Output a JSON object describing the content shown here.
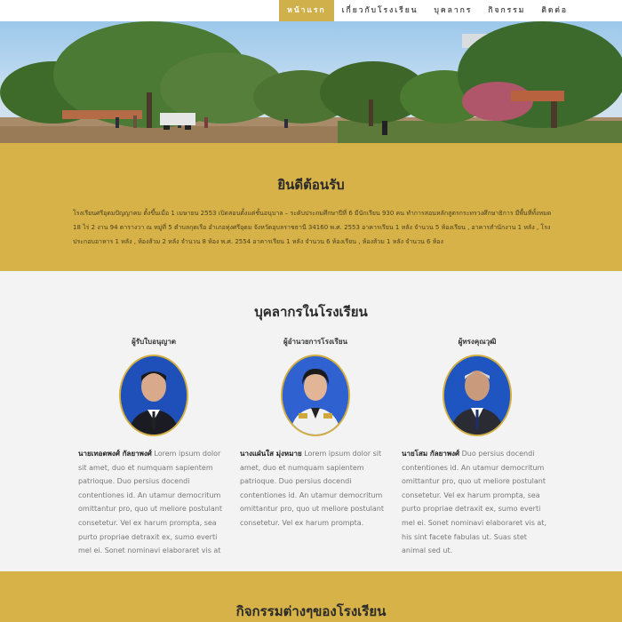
{
  "nav": {
    "items": [
      {
        "label": "หน้าแรก",
        "active": true
      },
      {
        "label": "เกี่ยวกับโรงเรียน",
        "active": false
      },
      {
        "label": "บุคลากร",
        "active": false
      },
      {
        "label": "กิจกรรม",
        "active": false
      },
      {
        "label": "ติดต่อ",
        "active": false
      }
    ]
  },
  "welcome": {
    "title": "ยินดีต้อนรับ",
    "text": "โรงเรียนศรีอุดมปัญญาคม ตั้งขึ้นเมื่อ 1 เมษายน 2553 เปิดสอนตั้งแต่ชั้นอนุบาล – ระดับประถมศึกษาปีที่ 6 มีนักเรียน 930 คน ทำการสอนหลักสูตรกระทรวงศึกษาธิการ มีพื้นที่ทั้งหมด 18 ไร่ 2 งาน 94 ตารางวา ณ หมู่ที่ 5 ตำบลกุดเรือ อำเภอทุ่งศรีอุดม จังหวัดอุบลราชธานี 34160 พ.ศ. 2553 อาคารเรียน 1 หลัง จำนวน 5 ห้องเรียน , อาคารสำนักงาน 1 หลัง , โรงประกอบอาหาร 1 หลัง , ห้องส้วม 2 หลัง จำนวน 8 ห้อง พ.ศ. 2554 อาคารเรียน 1 หลัง จำนวน 6 ห้องเรียน , ห้องส้วม 1 หลัง จำนวน 6 ห้อง"
  },
  "staff": {
    "title": "บุคลากรในโรงเรียน",
    "people": [
      {
        "role": "ผู้รับใบอนุญาต",
        "name": "นายเทอดพงศ์ กัลยาพงศ์",
        "desc": " Lorem ipsum dolor sit amet, duo et numquam sapientem patrioque. Duo persius docendi contentiones id. An utamur democritum omittantur pro, quo ut meliore postulant consetetur. Vel ex harum prompta, sea purto propriae detraxit ex, sumo everti mel ei. Sonet nominavi elaboraret vis at"
      },
      {
        "role": "ผู้อำนวยการโรงเรียน",
        "name": "นางแฝ่นใส มุ่งหมาย",
        "desc": " Lorem ipsum dolor sit amet, duo et numquam sapientem patrioque. Duo persius docendi contentiones id. An utamur democritum omittantur pro, quo ut meliore postulant consetetur. Vel ex harum prompta."
      },
      {
        "role": "ผู้ทรงคุณวุฒิ",
        "name": "นายโสม กัลยาพงศ์",
        "desc": " Duo persius docendi contentiones id. An utamur democritum omittantur pro, quo ut meliore postulant consetetur. Vel ex harum prompta, sea purto propriae detraxit ex, sumo everti mel ei. Sonet nominavi elaboraret vis at, his sint facete fabulas ut. Suas stet animal sed ut."
      }
    ]
  },
  "activities": {
    "title": "กิจกรรมต่างๆของโรงเรียน"
  },
  "colors": {
    "accent": "#d6b248",
    "nav_active": "#cfb04a",
    "portrait_border": "#d3ae3e"
  }
}
